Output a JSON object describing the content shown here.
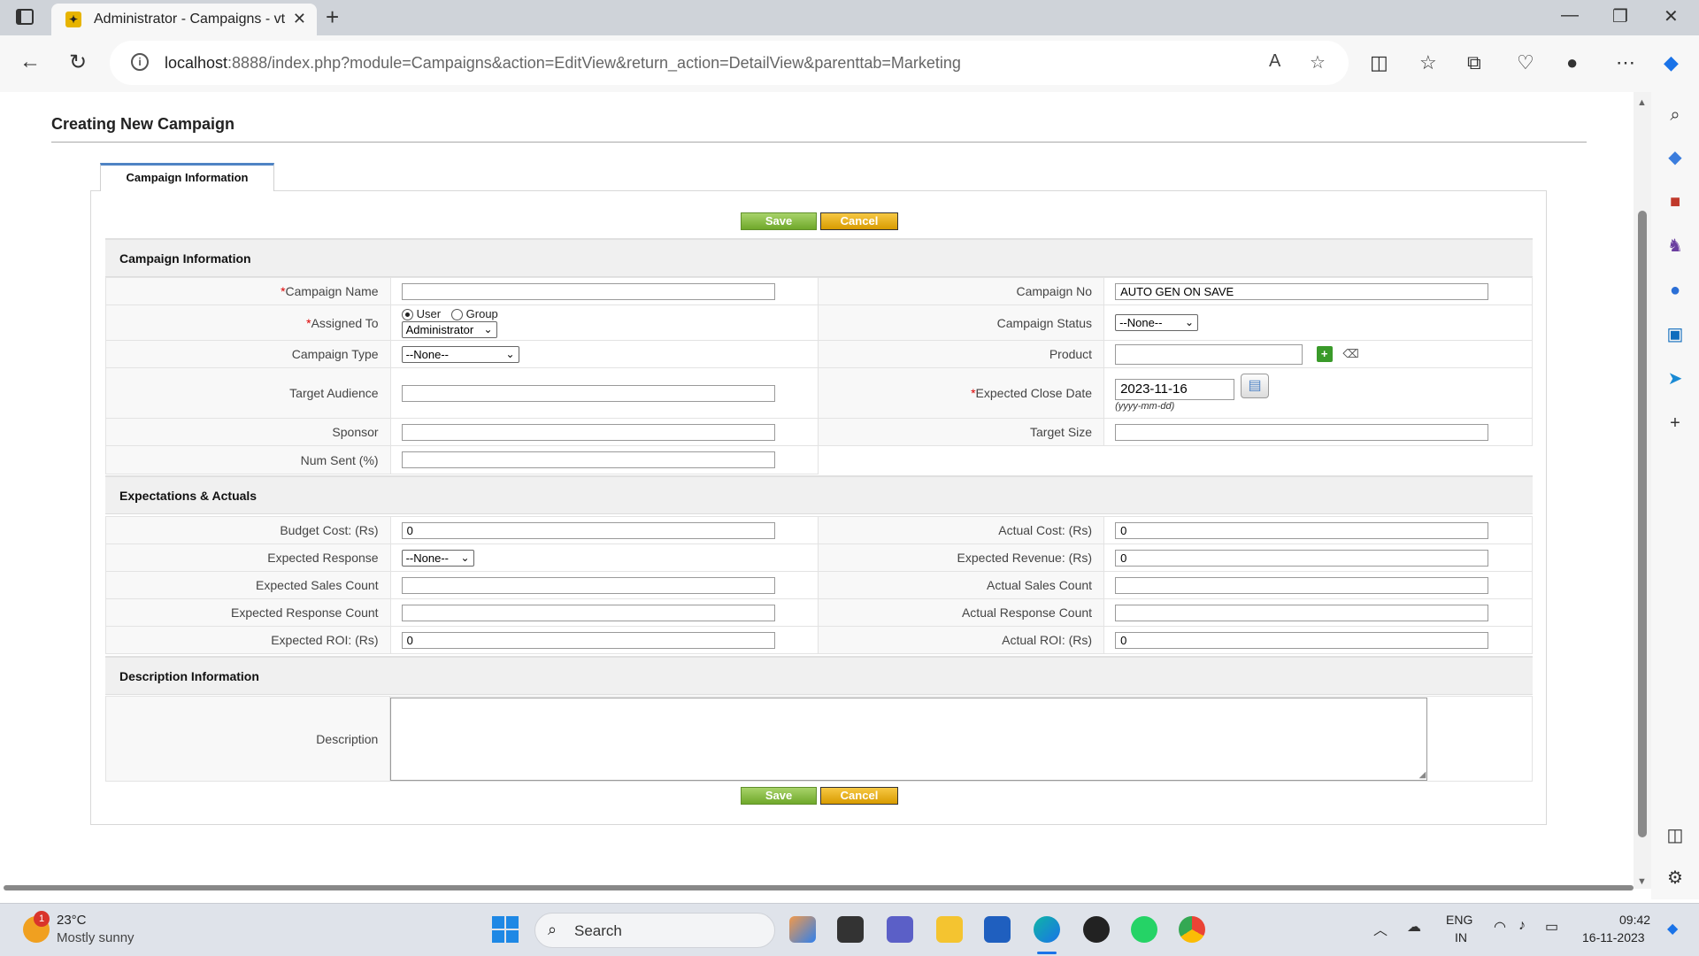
{
  "browser": {
    "tab_title": "Administrator - Campaigns - vtig",
    "url_host": "localhost",
    "url_rest": ":8888/index.php?module=Campaigns&action=EditView&return_action=DetailView&parenttab=Marketing"
  },
  "page": {
    "title": "Creating New Campaign",
    "tab_label": "Campaign Information",
    "save_label": "Save",
    "cancel_label": "Cancel"
  },
  "sections": {
    "campaign_info": "Campaign Information",
    "expectations": "Expectations & Actuals",
    "description": "Description Information"
  },
  "fields": {
    "campaign_name": {
      "label": "Campaign Name",
      "required": "*",
      "value": ""
    },
    "campaign_no": {
      "label": "Campaign No",
      "value": "AUTO GEN ON SAVE"
    },
    "assigned_to": {
      "label": "Assigned To",
      "required": "*",
      "opt_user": "User",
      "opt_group": "Group",
      "selected": "Administrator"
    },
    "campaign_status": {
      "label": "Campaign Status",
      "selected": "--None--"
    },
    "campaign_type": {
      "label": "Campaign Type",
      "selected": "--None--"
    },
    "product": {
      "label": "Product",
      "value": ""
    },
    "target_audience": {
      "label": "Target Audience",
      "value": ""
    },
    "expected_close_date": {
      "label": "Expected Close Date",
      "required": "*",
      "value": "2023-11-16",
      "format_hint": "(yyyy-mm-dd)"
    },
    "sponsor": {
      "label": "Sponsor",
      "value": ""
    },
    "target_size": {
      "label": "Target Size",
      "value": ""
    },
    "num_sent": {
      "label": "Num Sent (%)",
      "value": ""
    },
    "budget_cost": {
      "label": "Budget Cost: (Rs)",
      "value": "0"
    },
    "actual_cost": {
      "label": "Actual Cost: (Rs)",
      "value": "0"
    },
    "expected_response": {
      "label": "Expected Response",
      "selected": "--None--"
    },
    "expected_revenue": {
      "label": "Expected Revenue: (Rs)",
      "value": "0"
    },
    "expected_sales_count": {
      "label": "Expected Sales Count",
      "value": ""
    },
    "actual_sales_count": {
      "label": "Actual Sales Count",
      "value": ""
    },
    "expected_response_count": {
      "label": "Expected Response Count",
      "value": ""
    },
    "actual_response_count": {
      "label": "Actual Response Count",
      "value": ""
    },
    "expected_roi": {
      "label": "Expected ROI: (Rs)",
      "value": "0"
    },
    "actual_roi": {
      "label": "Actual ROI: (Rs)",
      "value": "0"
    },
    "description": {
      "label": "Description",
      "value": ""
    }
  },
  "taskbar": {
    "weather_temp": "23°C",
    "weather_desc": "Mostly sunny",
    "weather_badge": "1",
    "search_label": "Search",
    "lang_line1": "ENG",
    "lang_line2": "IN",
    "time": "09:42",
    "date": "16-11-2023"
  },
  "colors": {
    "save_button": "#7fb439",
    "cancel_button": "#e6a800",
    "tab_accent": "#4f83c4",
    "required": "#dd0000"
  }
}
